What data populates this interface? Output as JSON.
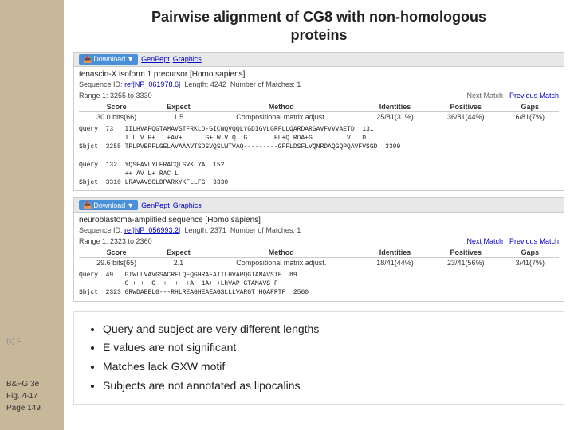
{
  "sidebar": {
    "label1": "B&FG 3e",
    "label2": "Fig. 4-17",
    "label3": "Page 149",
    "watermark": "(c) F"
  },
  "title": {
    "line1": "Pairwise alignment of CG8 with non-homologous",
    "line2": "proteins"
  },
  "panel1": {
    "download_label": "Download",
    "genpept_label": "GenPept",
    "graphics_label": "Graphics",
    "sequence_title": "tenascin-X isoform 1 precursor [Homo sapiens]",
    "sequence_id_label": "Sequence ID:",
    "sequence_id": "ref|NP_061978.6|",
    "length_label": "Length: 4242",
    "matches_label": "Number of Matches: 1",
    "range_label": "Range 1: 3255 to 3330",
    "next_match": "Next Match",
    "prev_match": "Previous Match",
    "col_score": "Score",
    "col_expect": "Expect",
    "col_method": "Method",
    "col_identities": "Identities",
    "col_positives": "Positives",
    "col_gaps": "Gaps",
    "score_val": "30.0 bits(66)",
    "expect_val": "1.5",
    "method_val": "Compositional matrix adjust.",
    "identities_val": "25/81(31%)",
    "positives_val": "36/81(44%)",
    "gaps_val": "6/81(7%)",
    "alignment": [
      {
        "label": "Query",
        "pos_left": "73",
        "seq": "IILHVAPQGTAMAVSTFRKLD-GICWQVQQLYGDIGVLGRFLLQARDARGAVFVVVAETD",
        "pos_right": "131"
      },
      {
        "label": "",
        "pos_left": "",
        "seq": "I L V P+   +AV+      G+ W V Q  G       FL+Q RDA+G         V   D",
        "pos_right": ""
      },
      {
        "label": "Sbjct",
        "pos_left": "3255",
        "seq": "TPLPVEPFLGELAVAAAVTSDSVQSLWTVAQ---------GFFLDSFLVQNRDAQ GQPQAVFVSGD",
        "pos_right": "3309"
      },
      {
        "label": "Query",
        "pos_left": "132",
        "seq": "YQSFAVLYLERACQLSVKLYA  152",
        "pos_right": ""
      },
      {
        "label": "",
        "pos_left": "",
        "seq": "++ AV L+ RAC L    ",
        "pos_right": ""
      },
      {
        "label": "Sbjct",
        "pos_left": "3310",
        "seq": "LRAVAVSGLDPARKYKFLLFG  3330",
        "pos_right": ""
      }
    ]
  },
  "panel2": {
    "download_label": "Download",
    "genpept_label": "GenPept",
    "graphics_label": "Graphics",
    "sequence_title": "neuroblastoma-amplified sequence [Homo sapiens]",
    "sequence_id_label": "Sequence ID:",
    "sequence_id": "ref|NP_056993.2|",
    "length_label": "Length: 2371",
    "matches_label": "Number of Matches: 1",
    "range_label": "Range 1: 2323 to 2360",
    "next_match": "Next Match",
    "prev_match": "Previous Match",
    "col_score": "Score",
    "col_expect": "Expect",
    "col_method": "Method",
    "col_identities": "Identities",
    "col_positives": "Positives",
    "col_gaps": "Gaps",
    "score_val": "29.6 bits(65)",
    "expect_val": "2.1",
    "method_val": "Compositional matrix adjust.",
    "identities_val": "18/41(44%)",
    "positives_val": "23/41(56%)",
    "gaps_val": "3/41(7%)",
    "alignment": [
      {
        "label": "Query",
        "pos_left": "49",
        "seq": "GTWLLVAVGSACRFLQEQGHRAEATILHVAPQGTAMAVSTF  89",
        "pos_right": ""
      },
      {
        "label": "",
        "pos_left": "",
        "seq": "G + +  G  +  +  +A  1A+ +LhVAP GTAMAVS F",
        "pos_right": ""
      },
      {
        "label": "Sbjct",
        "pos_left": "2323",
        "seq": "GRWDAEELG---RHLREAGHEAEAGSLLLVARGT HQAFRTF  2560",
        "pos_right": ""
      }
    ]
  },
  "bullets": {
    "items": [
      "Query and subject are very different lengths",
      "E values are not significant",
      "Matches lack GXW motif",
      "Subjects are not annotated as lipocalins"
    ]
  }
}
